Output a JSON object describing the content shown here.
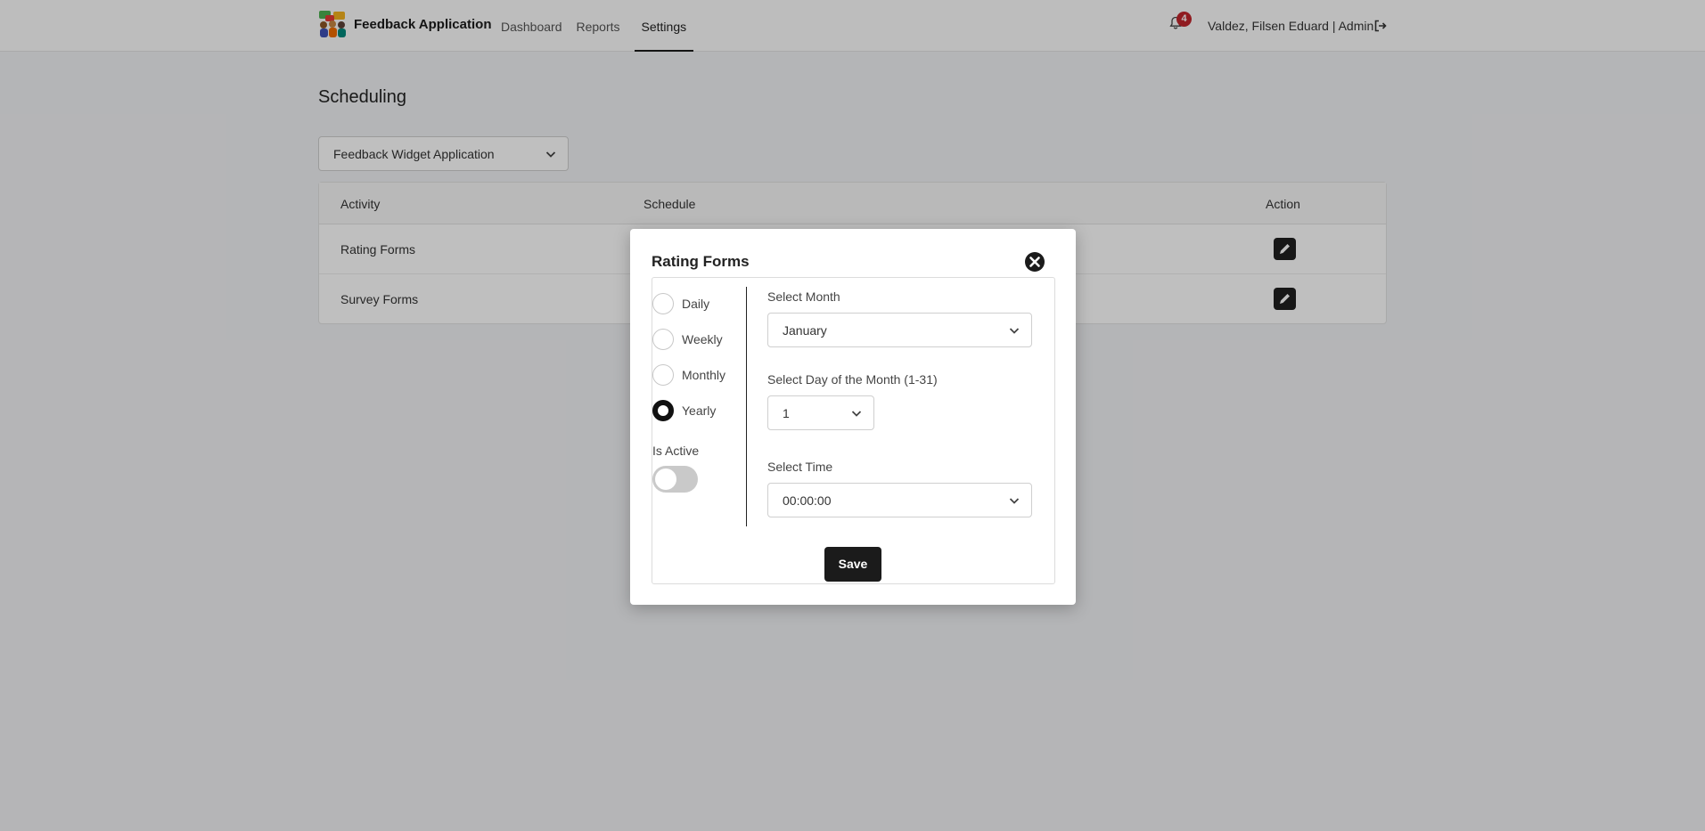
{
  "app": {
    "name": "Feedback Application"
  },
  "nav": {
    "items": [
      {
        "label": "Dashboard"
      },
      {
        "label": "Reports"
      },
      {
        "label": "Settings"
      }
    ]
  },
  "header": {
    "notification_count": "4",
    "user": "Valdez, Filsen Eduard | Admin"
  },
  "page": {
    "title": "Scheduling",
    "application_select": "Feedback Widget Application"
  },
  "table": {
    "columns": [
      "Activity",
      "Schedule",
      "Action"
    ],
    "rows": [
      {
        "activity": "Rating Forms",
        "schedule": ""
      },
      {
        "activity": "Survey Forms",
        "schedule": ""
      }
    ]
  },
  "modal": {
    "title": "Rating Forms",
    "frequencies": [
      "Daily",
      "Weekly",
      "Monthly",
      "Yearly"
    ],
    "selected_frequency": "Yearly",
    "is_active_label": "Is Active",
    "is_active": false,
    "month_label": "Select Month",
    "month_value": "January",
    "day_label": "Select Day of the Month (1-31)",
    "day_value": "1",
    "time_label": "Select Time",
    "time_value": "00:00:00",
    "save_label": "Save"
  },
  "colors": {
    "primary": "#1b1b1b",
    "badge": "#c0262d",
    "toggle_off": "#c9c9c9"
  },
  "icons": [
    "app-logo-icon",
    "bell-icon",
    "logout-icon",
    "chevron-down-icon",
    "pencil-icon",
    "close-icon"
  ]
}
